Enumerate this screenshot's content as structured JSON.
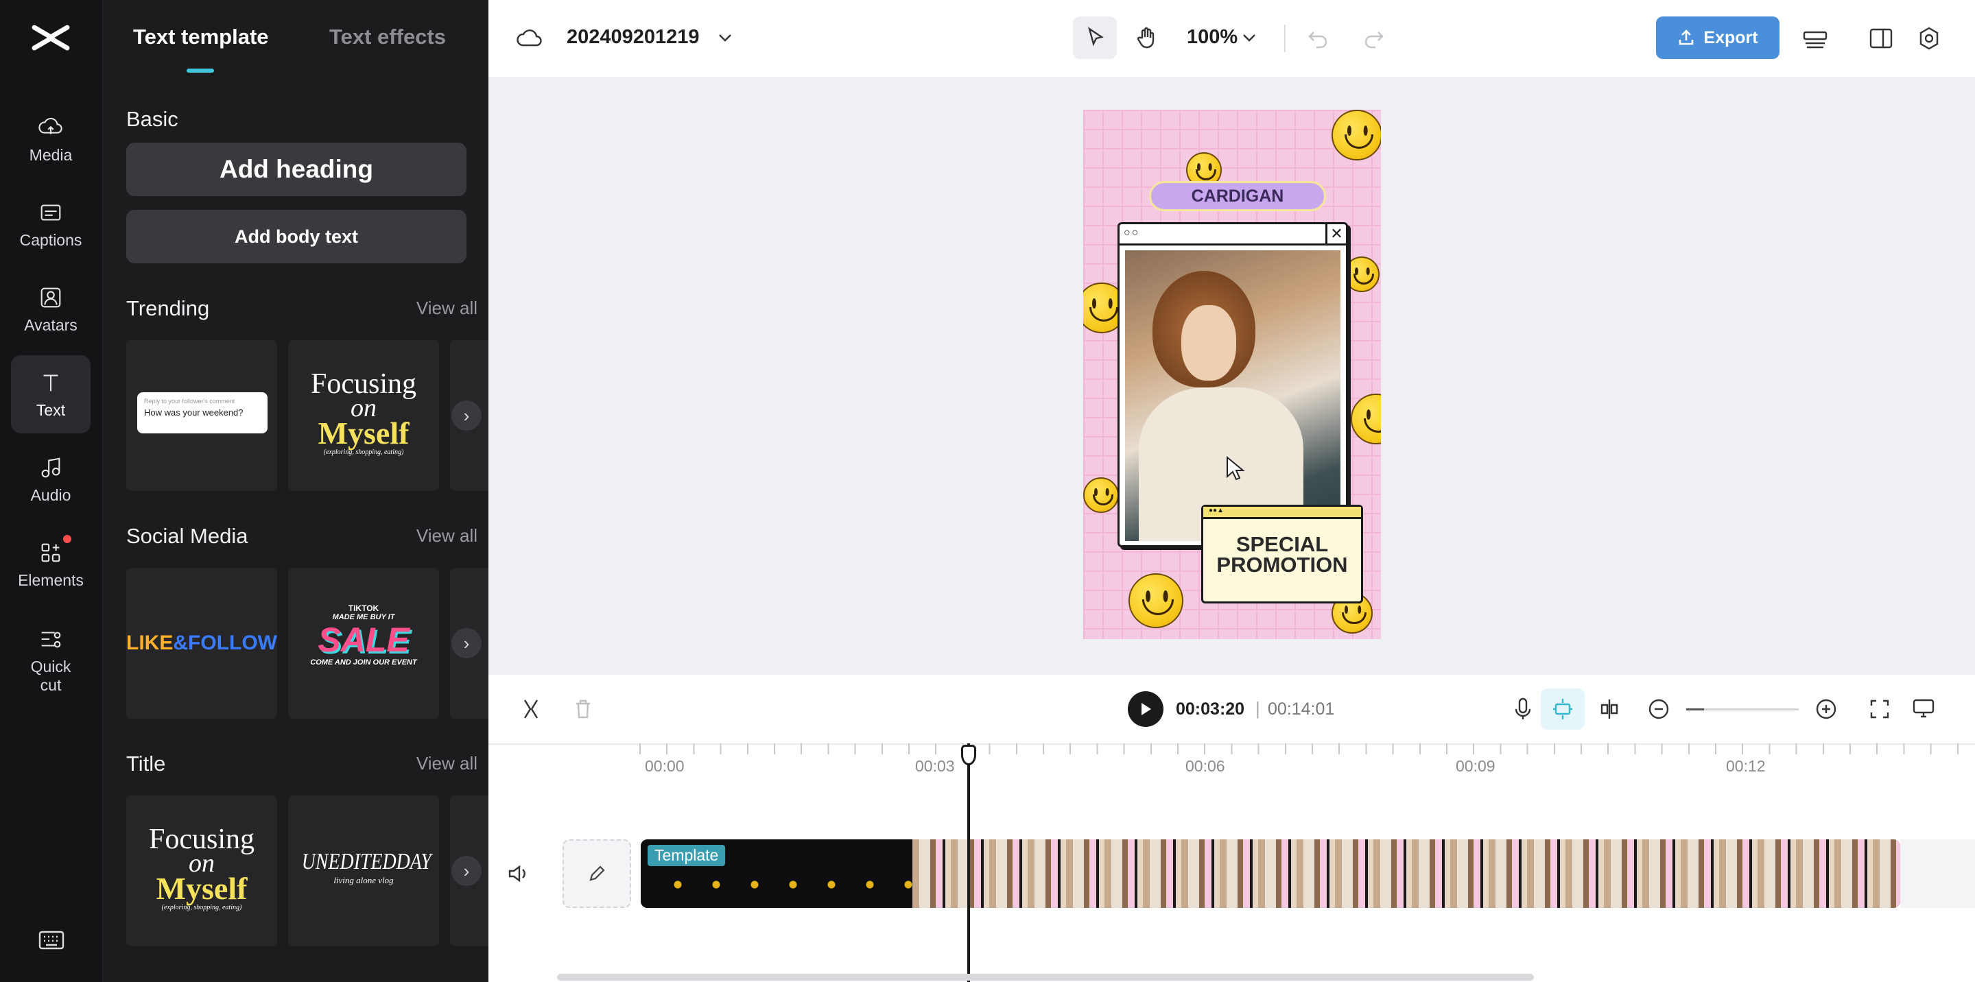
{
  "rail": {
    "items": [
      {
        "label": "Media",
        "icon": "cloud-upload-icon"
      },
      {
        "label": "Captions",
        "icon": "captions-icon"
      },
      {
        "label": "Avatars",
        "icon": "avatar-icon"
      },
      {
        "label": "Text",
        "icon": "text-icon",
        "active": true
      },
      {
        "label": "Audio",
        "icon": "music-note-icon"
      },
      {
        "label": "Elements",
        "icon": "elements-icon"
      },
      {
        "label": "Quick",
        "label2": "cut",
        "icon": "quick-cut-icon"
      }
    ]
  },
  "panel": {
    "tabs": [
      {
        "label": "Text template",
        "active": true
      },
      {
        "label": "Text effects"
      }
    ],
    "basic": {
      "title": "Basic",
      "add_heading": "Add heading",
      "add_body": "Add body text"
    },
    "trending": {
      "title": "Trending",
      "view_all": "View all",
      "card1_small": "Reply to your follower's comment",
      "card1_text": "How was your weekend?",
      "card2_line1": "Focusing",
      "card2_line2": "on",
      "card2_line3": "Myself",
      "card2_line4": "(exploring, shopping, eating)"
    },
    "social": {
      "title": "Social Media",
      "view_all": "View all",
      "card1_a": "LIKE",
      "card1_b": "&FOLLOW",
      "card2_top": "TIKTOK",
      "card2_sub": "MADE ME BUY IT",
      "card2_main": "SALE",
      "card2_bottom": "COME AND JOIN OUR EVENT"
    },
    "title_sec": {
      "title": "Title",
      "view_all": "View all",
      "card1_line1": "Focusing",
      "card1_line2": "on",
      "card1_line3": "Myself",
      "card1_line4": "(exploring, shopping, eating)",
      "card2_main": "UNEDITEDDAY",
      "card2_sub": "living alone vlog"
    }
  },
  "topbar": {
    "project_name": "202409201219",
    "zoom": "100%",
    "export_label": "Export"
  },
  "poster": {
    "label_top": "CARDIGAN",
    "promo_line1": "SPECIAL",
    "promo_line2": "PROMOTION"
  },
  "playback": {
    "current_time": "00:03:20",
    "separator": "|",
    "total_time": "00:14:01"
  },
  "timeline": {
    "ticks": [
      "00:00",
      "00:03",
      "00:06",
      "00:09",
      "00:12"
    ],
    "clip_label": "Template"
  },
  "colors": {
    "accent": "#4a8fd9",
    "tab_underline": "#3fc6d9",
    "poster_bg": "#f6c9e3"
  }
}
